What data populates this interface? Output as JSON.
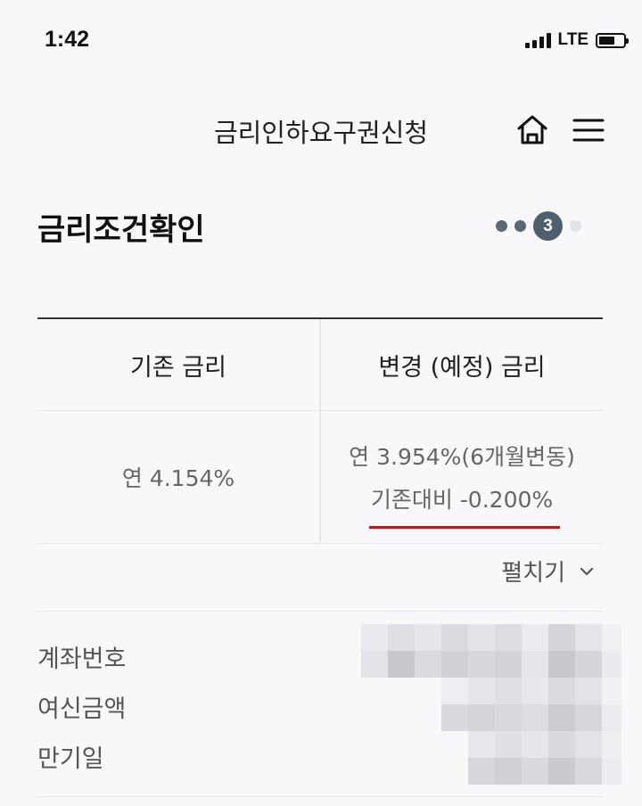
{
  "status": {
    "time": "1:42",
    "network": "LTE",
    "battery_level": 0.58
  },
  "header": {
    "title": "금리인하요구권신청",
    "home_icon": "home-icon",
    "menu_icon": "hamburger-menu-icon"
  },
  "section": {
    "title": "금리조건확인",
    "steps": {
      "total": 4,
      "current": "3"
    }
  },
  "rates": {
    "current_label": "기존 금리",
    "changed_label": "변경 (예정) 금리",
    "current_value": "연 4.154%",
    "changed_value": "연 3.954%(6개월변동)",
    "difference": "기존대비 -0.200%",
    "highlight_color": "#c8101a"
  },
  "expand": {
    "label": "펼치기",
    "icon": "chevron-down-icon"
  },
  "details": [
    {
      "label": "계좌번호"
    },
    {
      "label": "여신금액"
    },
    {
      "label": "만기일"
    }
  ]
}
